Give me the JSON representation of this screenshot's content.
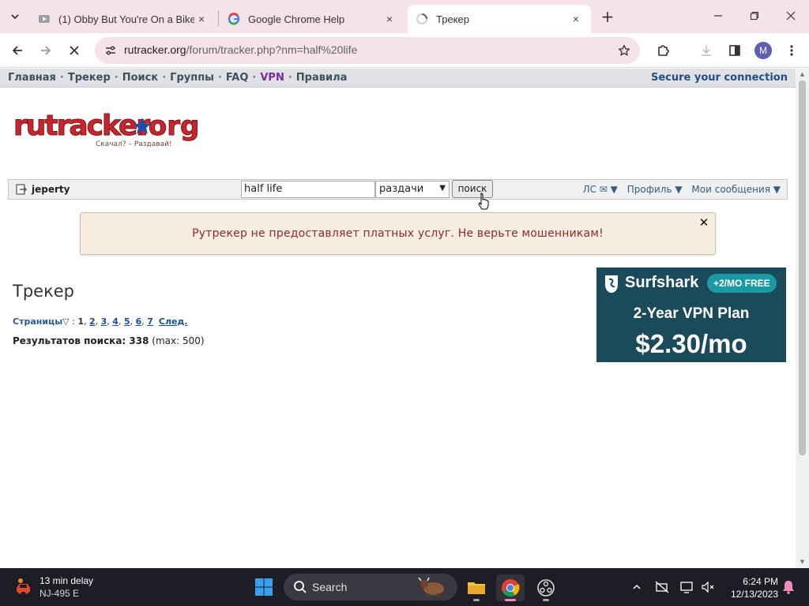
{
  "browser": {
    "tabs": [
      {
        "title": "(1) Obby But You're On a Bike -",
        "close": "×"
      },
      {
        "title": "Google Chrome Help",
        "close": "×"
      },
      {
        "title": "Трекер",
        "close": "×"
      }
    ],
    "new_tab": "+",
    "url_host": "rutracker.org",
    "url_path": "/forum/tracker.php?nm=half%20life",
    "profile_initial": "M"
  },
  "site": {
    "nav": [
      "Главная",
      "Трекер",
      "Поиск",
      "Группы",
      "FAQ",
      "VPN",
      "Правила"
    ],
    "nav_sep": "·",
    "secure": "Secure your connection",
    "logo_text": "rutracker.org",
    "logo_tagline": "Скачал? – Раздавай!",
    "username": "jeperty",
    "search_value": "half life",
    "search_scope": "раздачи",
    "search_button": "поиск",
    "right_links": [
      "ЛС ✉ ▼",
      "Профиль ▼",
      "Мои сообщения ▼"
    ],
    "alert": "Рутрекер не предоставляет платных услуг. Не верьте мошенникам!",
    "heading": "Трекер",
    "pages_label": "Страницы",
    "pages_current": "1",
    "pages": [
      "2",
      "3",
      "4",
      "5",
      "6",
      "7"
    ],
    "next": "След.",
    "results_label": "Результатов поиска: 338",
    "results_max": "(max: 500)"
  },
  "ad": {
    "brand": "Surfshark",
    "badge": "+2/MO FREE",
    "plan": "2-Year VPN Plan",
    "price": "$2.30/mo"
  },
  "taskbar": {
    "weather_line1": "13 min delay",
    "weather_line2": "NJ-495 E",
    "search": "Search",
    "time": "6:24 PM",
    "date": "12/13/2023"
  },
  "colors": {
    "accent_nav": "#3d5060",
    "vpn": "#7c2b91",
    "secure": "#1e4e88",
    "alert_text": "#8b2a2a",
    "ad_bg": "#1b4a5b"
  }
}
